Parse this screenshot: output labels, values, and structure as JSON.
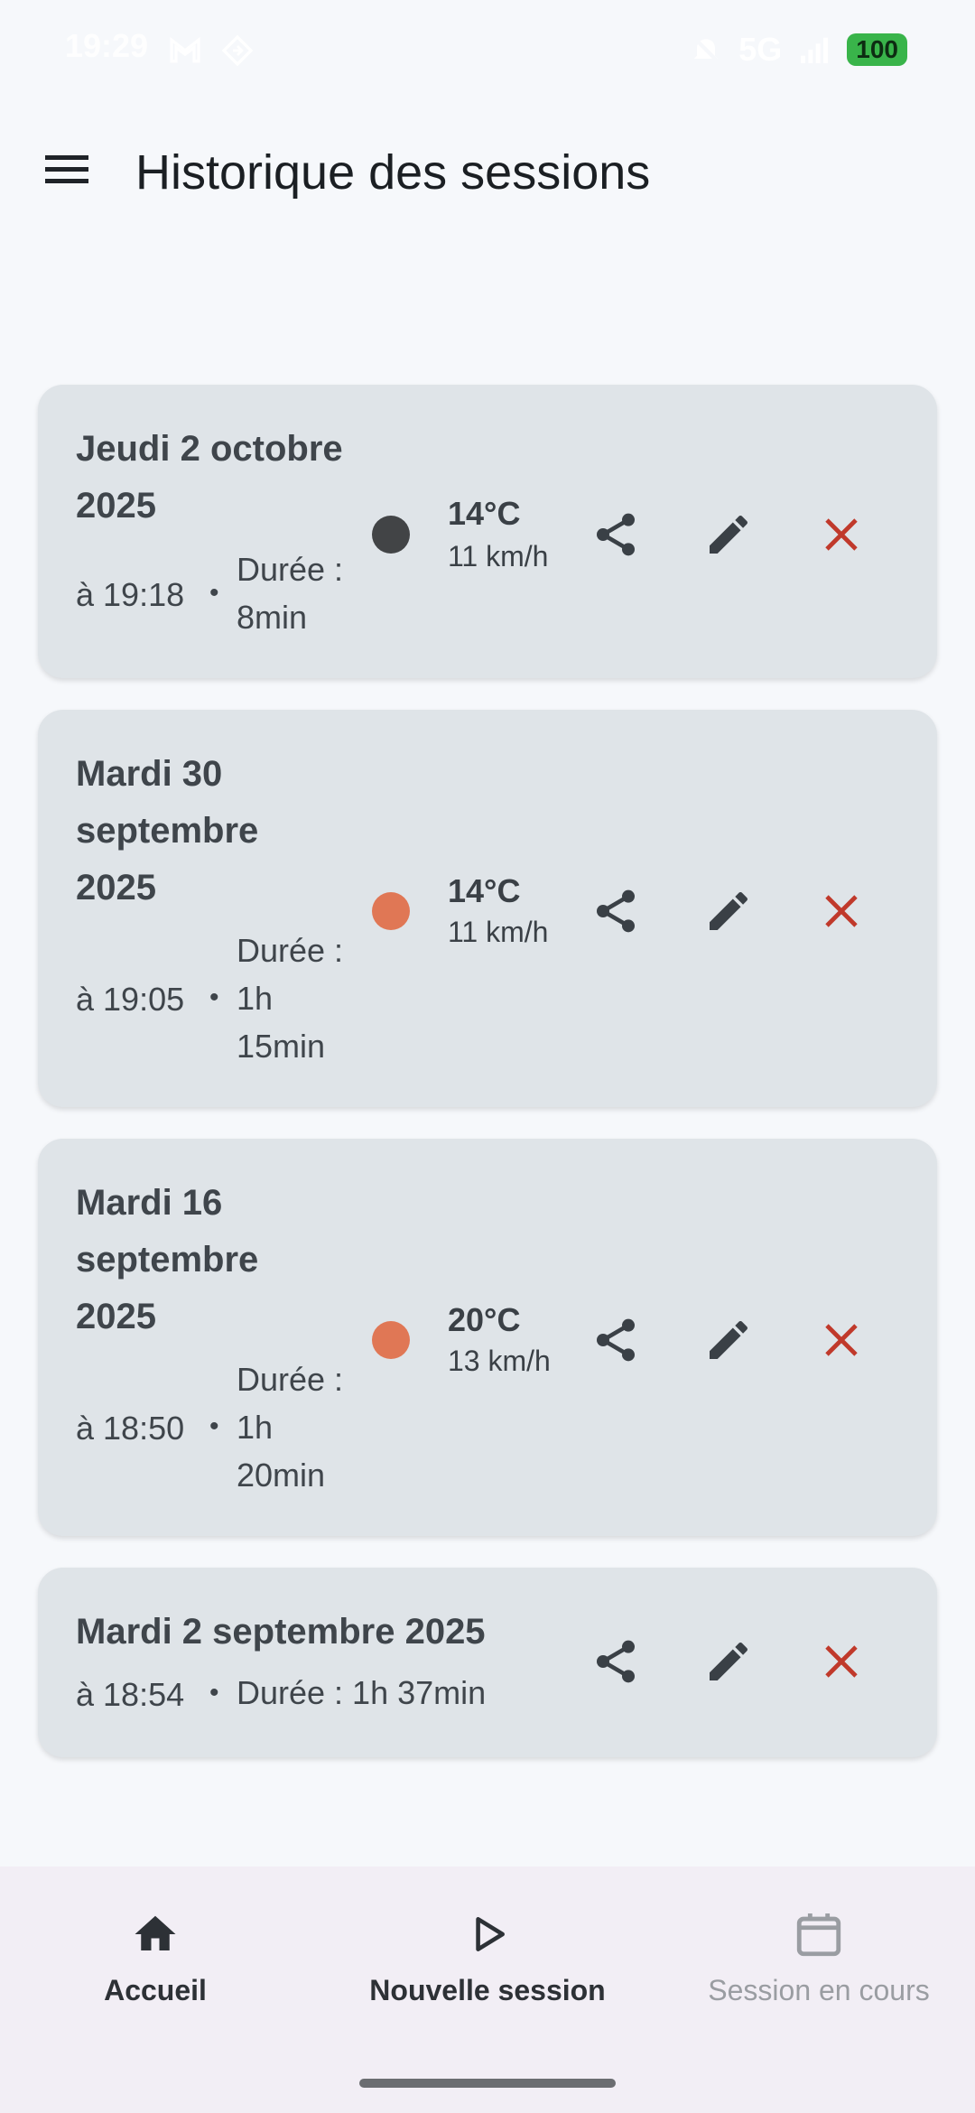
{
  "status_bar": {
    "time": "19:29",
    "network": "5G",
    "battery": "100"
  },
  "app_bar": {
    "title": "Historique des sessions",
    "menu_icon": "menu-icon"
  },
  "sessions": [
    {
      "date_lines": [
        "Jeudi 2 octobre",
        "2025"
      ],
      "time": "à 19:18",
      "separator": "•",
      "duration_lines": [
        "Durée :",
        "8min"
      ],
      "weather_color": "#424446",
      "temperature": "14°C",
      "wind": "11 km/h"
    },
    {
      "date_lines": [
        "Mardi 30",
        "septembre",
        "2025"
      ],
      "time": "à 19:05",
      "separator": "•",
      "duration_lines": [
        "Durée :",
        "1h",
        "15min"
      ],
      "weather_color": "#e07755",
      "temperature": "14°C",
      "wind": "11 km/h"
    },
    {
      "date_lines": [
        "Mardi 16",
        "septembre",
        "2025"
      ],
      "time": "à 18:50",
      "separator": "•",
      "duration_lines": [
        "Durée :",
        "1h",
        "20min"
      ],
      "weather_color": "#e07755",
      "temperature": "20°C",
      "wind": "13 km/h"
    },
    {
      "date_lines": [
        "Mardi 2 septembre 2025"
      ],
      "time": "à 18:54",
      "separator": "•",
      "duration_lines": [
        "Durée : 1h 37min"
      ]
    }
  ],
  "bottom_nav": {
    "items": [
      {
        "label": "Accueil",
        "icon": "home-icon",
        "enabled": true
      },
      {
        "label": "Nouvelle session",
        "icon": "play-icon",
        "enabled": true
      },
      {
        "label": "Session en cours",
        "icon": "calendar-icon",
        "enabled": false
      }
    ]
  },
  "colors": {
    "background": "#f6f8fb",
    "card": "#dfe4e8",
    "delete": "#c0392b",
    "icon": "#3a4046",
    "bottom_nav": "#f2eef5",
    "battery": "#39b44a"
  }
}
